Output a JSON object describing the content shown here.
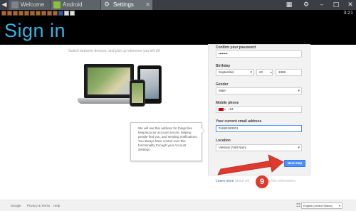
{
  "tabs": [
    {
      "label": "Welcome"
    },
    {
      "label": "Android"
    },
    {
      "label": "Settings"
    }
  ],
  "status": {
    "time": "3:21"
  },
  "header": {
    "title": "Sign in"
  },
  "promo": {
    "text": "Switch between devices, and pick up wherever you left off."
  },
  "form": {
    "confirm_password": {
      "label": "Confirm your password",
      "value": "••••••••"
    },
    "birthday": {
      "label": "Birthday",
      "month": "September",
      "day": "20",
      "year": "1989"
    },
    "gender": {
      "label": "Gender",
      "value": "Male"
    },
    "mobile": {
      "label": "Mobile phone",
      "value": "+84"
    },
    "email": {
      "label": "Your current email address",
      "value": "01693183301"
    },
    "location": {
      "label": "Location",
      "value": "Vietnam (Việt Nam)"
    },
    "next_label": "Next step"
  },
  "tooltip": {
    "text": "We will use this address for things like keeping your account secure, helping people find you, and sending notifications. You always have control over this functionality through your Account Settings."
  },
  "learn_more": {
    "link": "Learn more",
    "mid": " about wh",
    "end": "is this information."
  },
  "annotation": {
    "step": "9",
    "color": "#e03a2f"
  },
  "footer": {
    "google": "Google",
    "privacy": "Privacy & Terms",
    "help": "Help",
    "language": "English (United States)"
  },
  "colors": {
    "accent": "#33b5e5",
    "button": "#4d90fe",
    "arrow": "#e03a2f"
  }
}
